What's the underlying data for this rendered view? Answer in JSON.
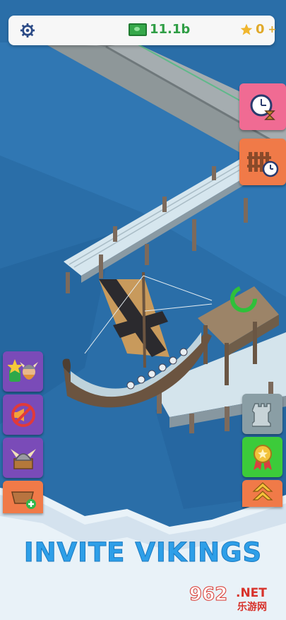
{
  "hud": {
    "money": "11.1b",
    "stars": "0",
    "stars_plus": "+"
  },
  "side_buttons_right": [
    {
      "name": "speed-boost",
      "icon": "clock-hourglass-icon",
      "color": "#f06b93"
    },
    {
      "name": "dock-timer",
      "icon": "fence-clock-icon",
      "color": "#f07a48"
    },
    {
      "name": "tower",
      "icon": "chess-rook-icon",
      "color": "#8a9ea5"
    },
    {
      "name": "medal",
      "icon": "medal-icon",
      "color": "#3ccb3a"
    },
    {
      "name": "rank-up",
      "icon": "chevrons-up-icon",
      "color": "#f07a48"
    }
  ],
  "side_buttons_left": [
    {
      "name": "viking-upgrade",
      "icon": "viking-star-icon",
      "color": "#7a4bb8"
    },
    {
      "name": "no-ads",
      "icon": "no-ads-icon",
      "color": "#7a4bb8"
    },
    {
      "name": "helmet-shop",
      "icon": "helmet-chest-icon",
      "color": "#7a4bb8"
    },
    {
      "name": "add-basket",
      "icon": "basket-plus-icon",
      "color": "#f07a48"
    }
  ],
  "caption": "INVITE VIKINGS",
  "watermark": {
    "number": "962",
    "suffix": ".NET",
    "cn": "乐游网"
  },
  "colors": {
    "water": "#2a6ea8",
    "caption": "#2e9fe8",
    "money": "#2f9e45",
    "star": "#e0a92a"
  }
}
